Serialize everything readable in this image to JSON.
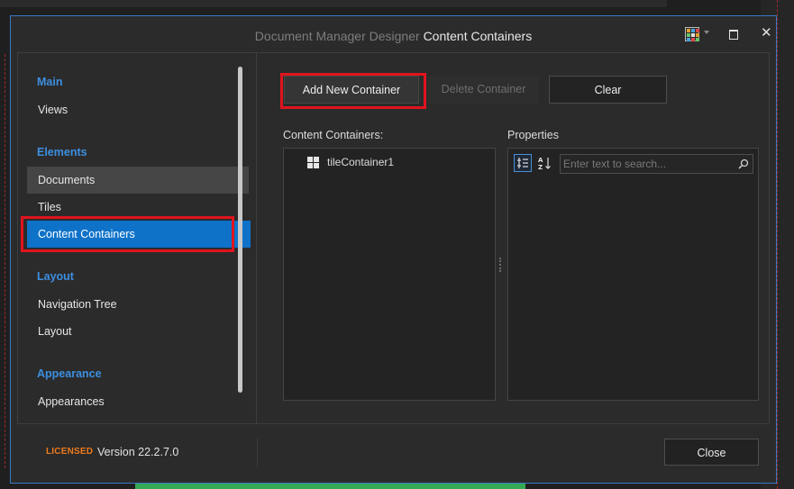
{
  "window": {
    "title_prefix": "Document Manager Designer",
    "title_section": "Content Containers"
  },
  "sidebar": {
    "groups": [
      {
        "label": "Main",
        "items": [
          "Views"
        ]
      },
      {
        "label": "Elements",
        "items": [
          "Documents",
          "Tiles",
          "Content Containers"
        ]
      },
      {
        "label": "Layout",
        "items": [
          "Navigation Tree",
          "Layout"
        ]
      },
      {
        "label": "Appearance",
        "items": [
          "Appearances"
        ]
      }
    ],
    "active_item": "Content Containers",
    "hover_item": "Documents"
  },
  "toolbar": {
    "add_label": "Add New Container",
    "delete_label": "Delete Container",
    "clear_label": "Clear"
  },
  "containers": {
    "header": "Content Containers:",
    "items": [
      "tileContainer1"
    ]
  },
  "properties": {
    "header": "Properties",
    "search_placeholder": "Enter text to search..."
  },
  "footer": {
    "license": "LICENSED",
    "version": "Version 22.2.7.0",
    "close_label": "Close"
  },
  "colors": {
    "accent": "#0e72c9",
    "group_header": "#3d8fe0",
    "highlight": "#e0141e",
    "license": "#ee7a1c"
  }
}
